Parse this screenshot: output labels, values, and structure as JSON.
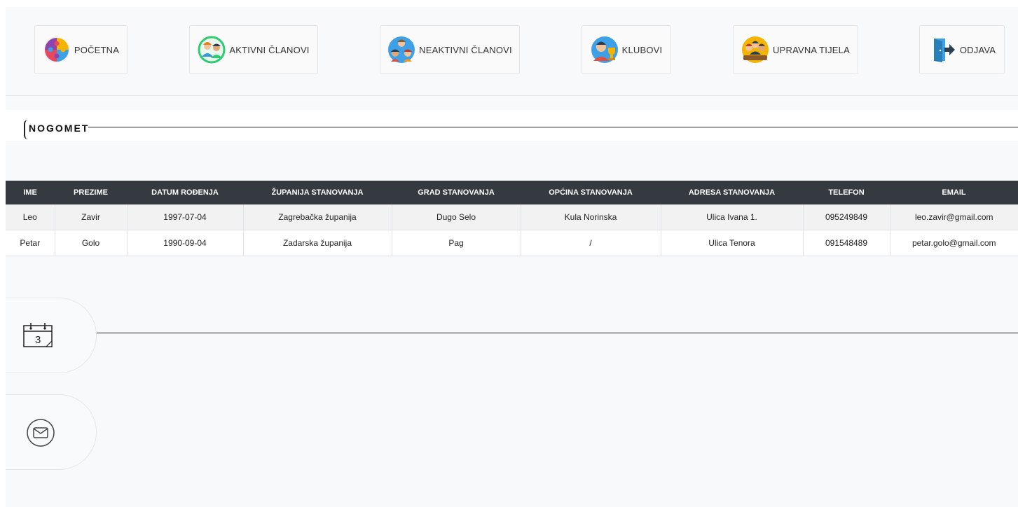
{
  "nav": [
    {
      "label": "POČETNA",
      "icon": "puzzle-icon"
    },
    {
      "label": "AKTIVNI ČLANOVI",
      "icon": "active-members-icon"
    },
    {
      "label": "NEAKTIVNI ČLANOVI",
      "icon": "inactive-members-icon"
    },
    {
      "label": "KLUBOVI",
      "icon": "trophy-icon"
    },
    {
      "label": "UPRAVNA TIJELA",
      "icon": "governing-bodies-icon"
    },
    {
      "label": "ODJAVA",
      "icon": "logout-door-icon"
    }
  ],
  "section": {
    "title": "NOGOMET"
  },
  "table": {
    "headers": [
      "IME",
      "PREZIME",
      "DATUM ROĐENJA",
      "ŽUPANIJA STANOVANJA",
      "GRAD STANOVANJA",
      "OPĆINA STANOVANJA",
      "ADRESA STANOVANJA",
      "TELEFON",
      "EMAIL"
    ],
    "rows": [
      [
        "Leo",
        "Zavir",
        "1997-07-04",
        "Zagrebačka županija",
        "Dugo Selo",
        "Kula Norinska",
        "Ulica Ivana 1.",
        "095249849",
        "leo.zavir@gmail.com"
      ],
      [
        "Petar",
        "Golo",
        "1990-09-04",
        "Zadarska županija",
        "Pag",
        "/",
        "Ulica Tenora",
        "091548489",
        "petar.golo@gmail.com"
      ]
    ]
  },
  "side": {
    "calendar": {
      "icon": "calendar-icon",
      "day": "3"
    },
    "mail": {
      "icon": "mail-icon"
    }
  },
  "colors": {
    "table_header_bg": "#343a40",
    "row_stripe": "#f2f2f2",
    "page_bg": "#f8f9fb"
  }
}
